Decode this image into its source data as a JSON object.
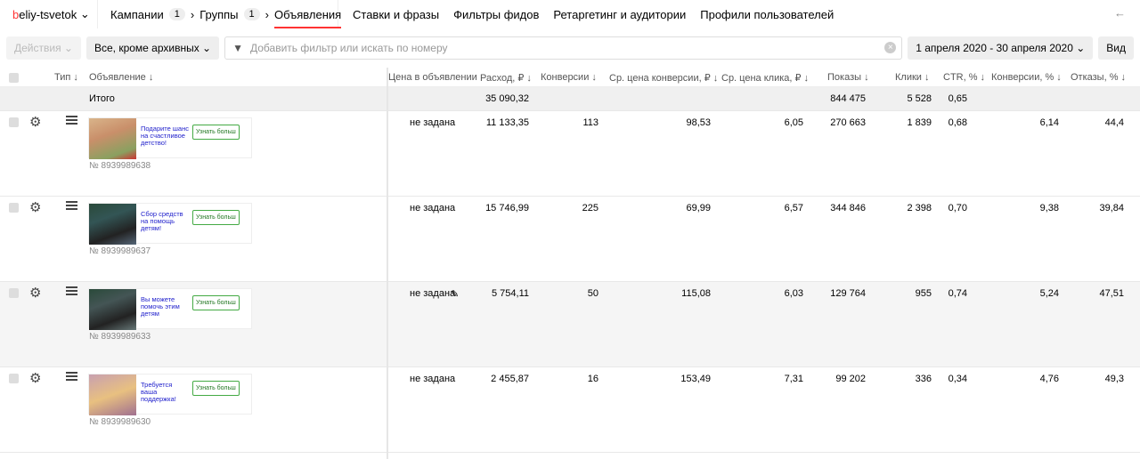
{
  "account": {
    "first": "b",
    "rest": "eliy-tsvetok"
  },
  "breadcrumb": [
    {
      "label": "Кампании",
      "count": "1"
    },
    {
      "label": "Группы",
      "count": "1"
    },
    {
      "label": "Объявления"
    }
  ],
  "nav": [
    "Ставки и фразы",
    "Фильтры фидов",
    "Ретаргетинг и аудитории",
    "Профили пользователей"
  ],
  "toolbar": {
    "actions": "Действия",
    "status": "Все, кроме архивных",
    "search_placeholder": "Добавить фильтр или искать по номеру",
    "date": "1 апреля 2020 - 30 апреля 2020",
    "view": "Вид"
  },
  "columns": {
    "type": "Тип ↓",
    "ad": "Объявление ↓",
    "price": "Цена в объявлении",
    "cost": "Расход, ₽ ↓",
    "conv": "Конверсии ↓",
    "cpa": "Ср. цена конверсии, ₽ ↓",
    "cpc": "Ср. цена клика, ₽ ↓",
    "shows": "Показы ↓",
    "clicks": "Клики ↓",
    "ctr": "CTR, % ↓",
    "cr": "Конверсии, % ↓",
    "bounce": "Отказы, % ↓"
  },
  "total": {
    "label": "Итого",
    "cost": "35 090,32",
    "shows": "844 475",
    "clicks": "5 528",
    "ctr": "0,65"
  },
  "rows": [
    {
      "text": "Подарите шанс на счастливое детство!",
      "btn": "Узнать больш",
      "num": "№ 8939989638",
      "price": "не задана",
      "cost": "11 133,35",
      "conv": "113",
      "cpa": "98,53",
      "cpc": "6,05",
      "shows": "270 663",
      "clicks": "1 839",
      "ctr": "0,68",
      "cr": "6,14",
      "bounce": "44,4"
    },
    {
      "text": "Сбор средств на помощь детям!",
      "btn": "Узнать больш",
      "num": "№ 8939989637",
      "price": "не задана",
      "cost": "15 746,99",
      "conv": "225",
      "cpa": "69,99",
      "cpc": "6,57",
      "shows": "344 846",
      "clicks": "2 398",
      "ctr": "0,70",
      "cr": "9,38",
      "bounce": "39,84"
    },
    {
      "text": "Вы можете помочь этим детям",
      "btn": "Узнать больш",
      "num": "№ 8939989633",
      "price": "не задана",
      "cost": "5 754,11",
      "conv": "50",
      "cpa": "115,08",
      "cpc": "6,03",
      "shows": "129 764",
      "clicks": "955",
      "ctr": "0,74",
      "cr": "5,24",
      "bounce": "47,51"
    },
    {
      "text": "Требуется ваша поддержка!",
      "btn": "Узнать больш",
      "num": "№ 8939989630",
      "price": "не задана",
      "cost": "2 455,87",
      "conv": "16",
      "cpa": "153,49",
      "cpc": "7,31",
      "shows": "99 202",
      "clicks": "336",
      "ctr": "0,34",
      "cr": "4,76",
      "bounce": "49,3"
    }
  ]
}
